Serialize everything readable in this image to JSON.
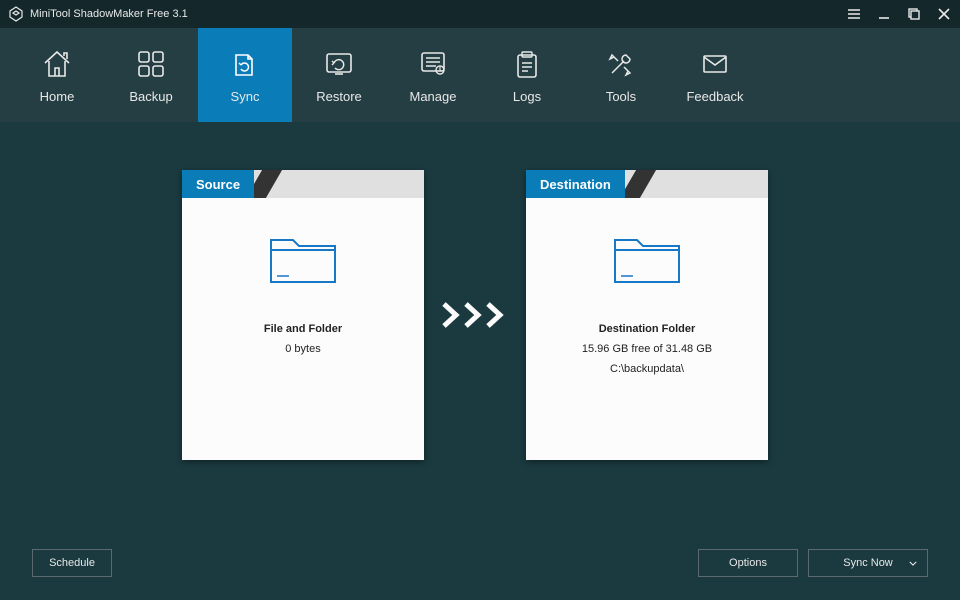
{
  "titlebar": {
    "title": "MiniTool ShadowMaker Free 3.1"
  },
  "nav": {
    "items": [
      {
        "label": "Home"
      },
      {
        "label": "Backup"
      },
      {
        "label": "Sync"
      },
      {
        "label": "Restore"
      },
      {
        "label": "Manage"
      },
      {
        "label": "Logs"
      },
      {
        "label": "Tools"
      },
      {
        "label": "Feedback"
      }
    ],
    "active_index": 2
  },
  "source": {
    "tab_label": "Source",
    "heading": "File and Folder",
    "line1": "0 bytes"
  },
  "destination": {
    "tab_label": "Destination",
    "heading": "Destination Folder",
    "line1": "15.96 GB free of 31.48 GB",
    "line2": "C:\\backupdata\\"
  },
  "footer": {
    "schedule_label": "Schedule",
    "options_label": "Options",
    "syncnow_label": "Sync Now"
  }
}
